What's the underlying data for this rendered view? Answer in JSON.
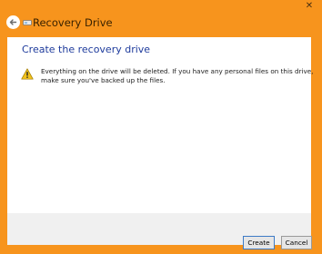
{
  "window": {
    "title": "Recovery Drive",
    "close_glyph": "✕"
  },
  "page": {
    "heading": "Create the recovery drive",
    "warning": "Everything on the drive will be deleted. If you have any personal files on this drive, make sure you've backed up the files."
  },
  "buttons": {
    "create": "Create",
    "cancel": "Cancel"
  },
  "icons": {
    "back": "back-arrow-icon",
    "drive": "drive-icon",
    "warning": "warning-icon"
  },
  "colors": {
    "accent": "#f7941d",
    "heading": "#1e3b9c"
  }
}
